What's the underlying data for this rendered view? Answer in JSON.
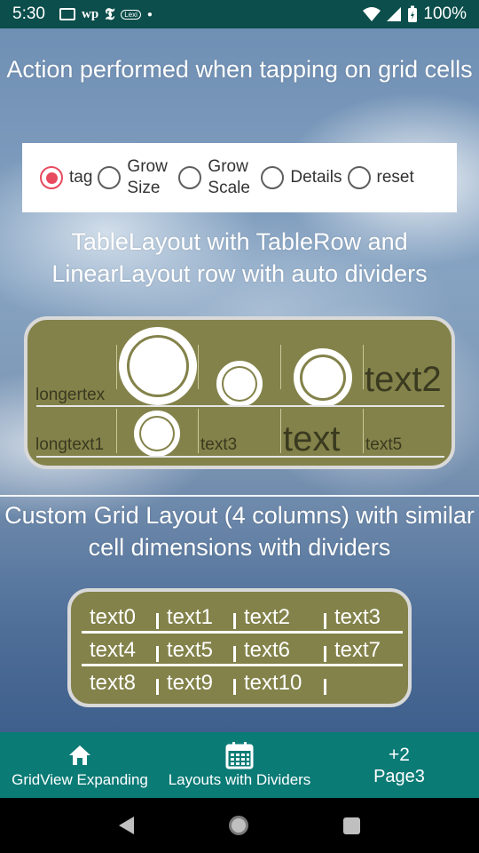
{
  "status_bar": {
    "time": "5:30",
    "icons": [
      "message-icon",
      "wp-icon",
      "nyt-icon",
      "app-icon",
      "dot-icon"
    ],
    "battery": "100%"
  },
  "headings": {
    "action": "Action performed when tapping on grid cells",
    "table_layout": "TableLayout with TableRow and LinearLayout row with auto dividers",
    "custom_grid": "Custom Grid Layout (4 columns) with similar cell dimensions with dividers"
  },
  "radio_group": {
    "options": [
      {
        "label": "tag",
        "checked": true
      },
      {
        "label": "Grow Size",
        "checked": false
      },
      {
        "label": "Grow Scale",
        "checked": false
      },
      {
        "label": "Details",
        "checked": false
      },
      {
        "label": "reset",
        "checked": false
      }
    ],
    "accent": "#e84a5f"
  },
  "table_layout": {
    "row1": [
      "longertex",
      "",
      "",
      "",
      "text2"
    ],
    "row2": [
      "longtext1",
      "",
      "text3",
      "text",
      "text5"
    ],
    "card_color": "#83824a"
  },
  "custom_grid": {
    "cells": [
      "text0",
      "text1",
      "text2",
      "text3",
      "text4",
      "text5",
      "text6",
      "text7",
      "text8",
      "text9",
      "text10"
    ]
  },
  "bottom_nav": {
    "items": [
      {
        "label": "GridView Expanding",
        "icon": "home-icon"
      },
      {
        "label": "Layouts with Dividers",
        "icon": "calendar-icon"
      },
      {
        "label": "Page3",
        "badge": "+2"
      }
    ],
    "color": "#0b7b76"
  }
}
